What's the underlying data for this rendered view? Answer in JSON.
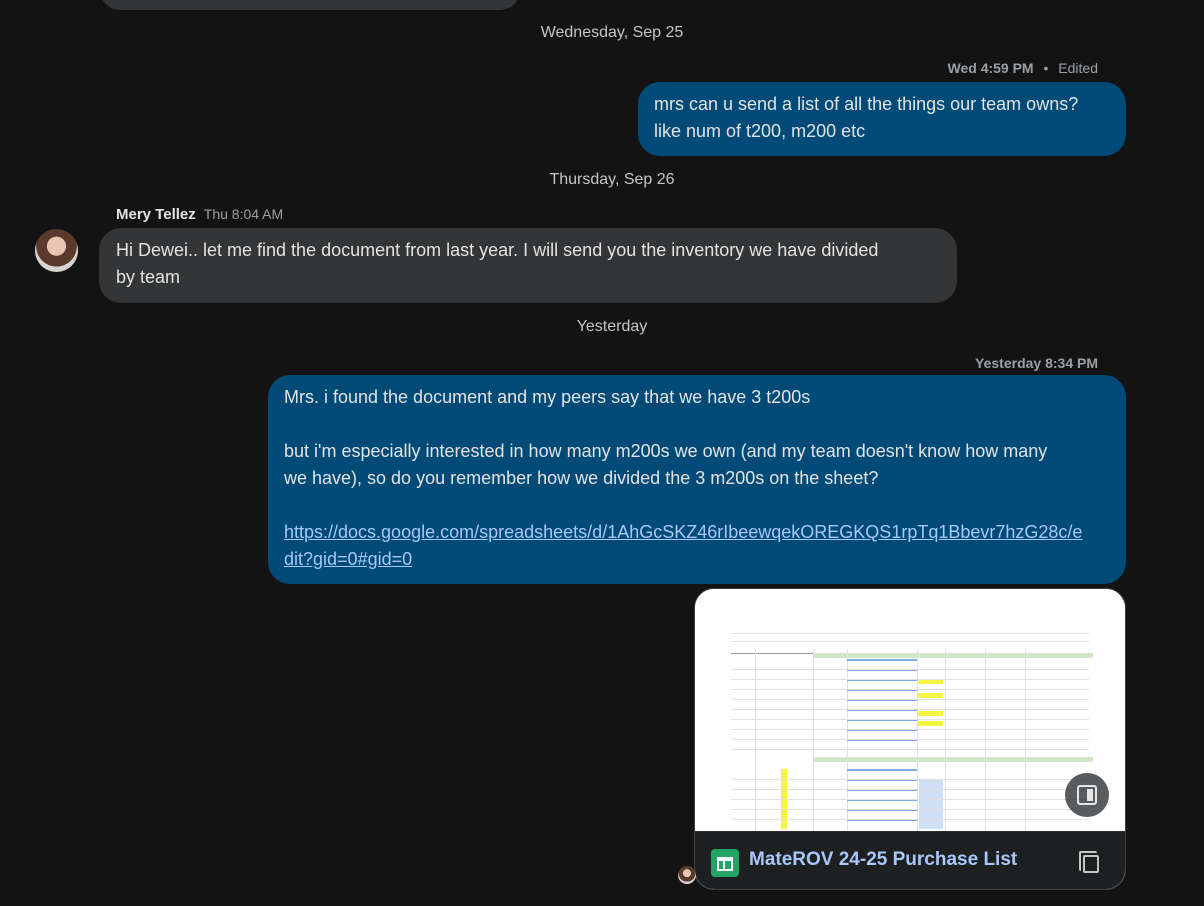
{
  "dates": {
    "sep25": "Wednesday, Sep 25",
    "sep26": "Thursday, Sep 26",
    "yesterday": "Yesterday"
  },
  "messages": {
    "m1": {
      "time": "Wed 4:59 PM",
      "edited": "Edited",
      "line1": "mrs can u send a list of all the things our team owns?",
      "line2": "like num of t200, m200 etc"
    },
    "m2": {
      "sender": "Mery Tellez",
      "time": "Thu 8:04 AM",
      "line1": "Hi Dewei.. let me find the document from last year.  I will send you the inventory we have divided",
      "line2": "by team"
    },
    "m3": {
      "time": "Yesterday 8:34 PM",
      "p1": "Mrs. i found the document and my peers say that we have 3 t200s",
      "p2a": "but i'm especially interested in how many m200s we own (and my team doesn't know how many",
      "p2b": "we have), so do you remember how we divided the 3 m200s on the sheet?",
      "link1": "https://docs.google.com/spreadsheets/d/1AhGcSKZ46rIbeewqekOREGKQS1rpTq1Bbevr7hzG28c/e",
      "link2": "dit?gid=0#gid=0"
    },
    "attachment": {
      "title": "MateROV 24-25 Purchase List",
      "icon": "google-sheets-icon"
    }
  },
  "colors": {
    "background": "#131314",
    "outgoing_bubble": "#004a77",
    "incoming_bubble": "#333537",
    "link": "#a8c7fa"
  }
}
